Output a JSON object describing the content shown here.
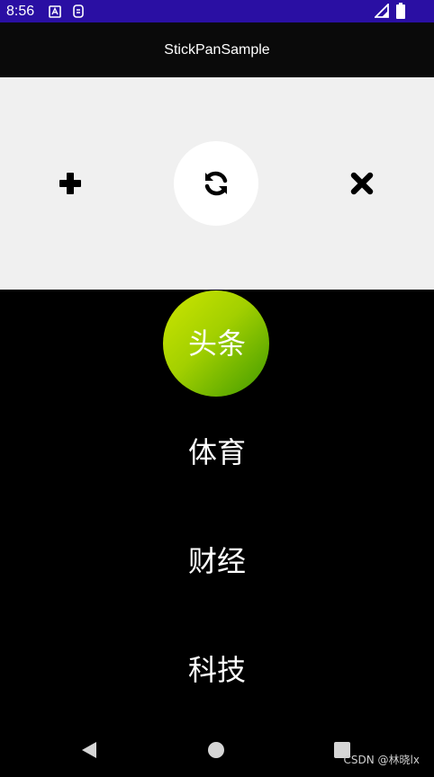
{
  "status_bar": {
    "time": "8:56",
    "icons": [
      "a-box-icon",
      "notification-icon",
      "signal-icon",
      "battery-icon"
    ]
  },
  "app": {
    "title": "StickPanSample"
  },
  "toolbar": {
    "add_icon": "plus-icon",
    "refresh_icon": "refresh-icon",
    "close_icon": "close-icon"
  },
  "tabs": [
    {
      "label": "头条",
      "active": true
    },
    {
      "label": "体育",
      "active": false
    },
    {
      "label": "财经",
      "active": false
    },
    {
      "label": "科技",
      "active": false
    }
  ],
  "nav": {
    "back_icon": "back-icon",
    "home_icon": "home-icon",
    "recents_icon": "recents-icon"
  },
  "watermark": "CSDN @林晓lx",
  "colors": {
    "status_bar": "#2a0fa3",
    "app_bar": "#0a0a0a",
    "toolbar_panel": "#f0f0f0",
    "active_tab_gradient_start": "#cde600",
    "active_tab_gradient_end": "#3f9a00"
  }
}
